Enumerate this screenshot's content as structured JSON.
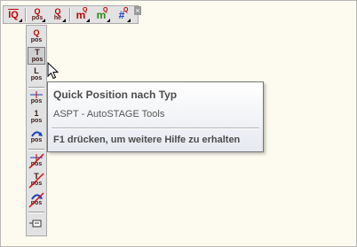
{
  "toolbar_horizontal": {
    "buttons": [
      {
        "name": "q-overline",
        "label": "IQ",
        "sub": ""
      },
      {
        "name": "q-pos",
        "label": "Q",
        "sub": "pos"
      },
      {
        "name": "q-he",
        "label": "Q",
        "sub": "he"
      },
      {
        "name": "m-q",
        "label": "m",
        "sup": "Q"
      },
      {
        "name": "m-q-green",
        "label": "m",
        "sup": "Q"
      },
      {
        "name": "hash-q",
        "label": "#",
        "sup": "Q"
      }
    ],
    "close_glyph": "×"
  },
  "toolbar_vertical": {
    "buttons": [
      {
        "top": "Q",
        "sub": "pos"
      },
      {
        "top": "T",
        "sub": "pos"
      },
      {
        "top": "L",
        "sub": "pos"
      },
      {
        "top": "",
        "sub": "pos"
      },
      {
        "top": "1",
        "sub": "pos"
      },
      {
        "top": "",
        "sub": "pos"
      },
      {
        "top": "",
        "sub": "pos"
      },
      {
        "top": "T",
        "sub": "pos"
      },
      {
        "top": "",
        "sub": "pos"
      }
    ],
    "selected_index": 1
  },
  "tooltip": {
    "title": "Quick Position nach Typ",
    "description": "ASPT - AutoSTAGE Tools",
    "help": "F1 drücken, um weitere Hilfe zu erhalten"
  },
  "colors": {
    "background": "#fdfbef",
    "toolbar": "#e2e2e2",
    "accent_red": "#c20000",
    "accent_green": "#2a8a1a",
    "accent_blue": "#1a3fc2"
  }
}
